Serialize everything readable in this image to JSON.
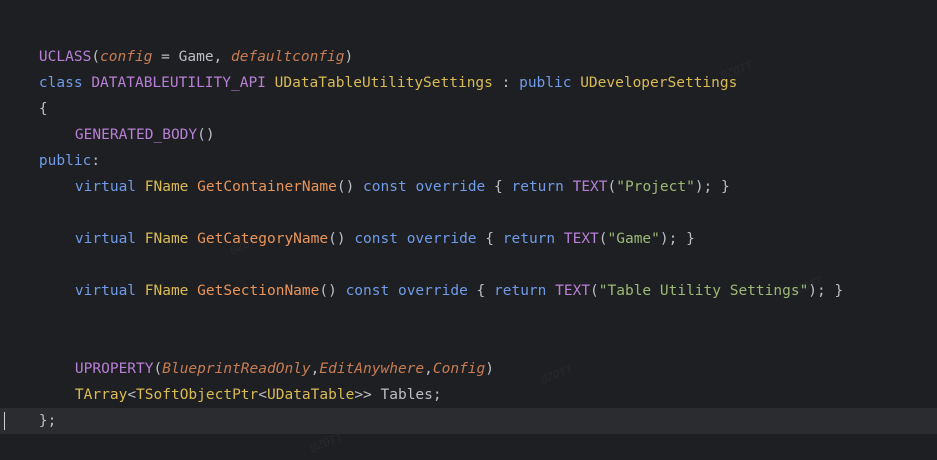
{
  "code_lines": {
    "l1": {
      "uclass": "UCLASS",
      "open": "(",
      "config": "config",
      "eq": " = Game, ",
      "defcfg": "defaultconfig",
      "close": ")"
    },
    "l2": {
      "class": "class ",
      "api": "DATATABLEUTILITY_API ",
      "name": "UDataTableUtilitySettings",
      "colon": " : ",
      "public": "public ",
      "base": "UDeveloperSettings"
    },
    "l3": {
      "brace": "{"
    },
    "l4": {
      "macro": "GENERATED_BODY",
      "parens": "()"
    },
    "l5": {
      "public": "public",
      ":": ":"
    },
    "l6": {
      "virtual": "virtual ",
      "type": "FName ",
      "func": "GetContainerName",
      "p1": "() ",
      "const": "const ",
      "override": "override ",
      "b1": "{ ",
      "ret": "return ",
      "text": "TEXT",
      "o": "(",
      "str": "\"Project\"",
      "c": "); }"
    },
    "l8": {
      "virtual": "virtual ",
      "type": "FName ",
      "func": "GetCategoryName",
      "p1": "() ",
      "const": "const ",
      "override": "override ",
      "b1": "{ ",
      "ret": "return ",
      "text": "TEXT",
      "o": "(",
      "str": "\"Game\"",
      "c": "); }"
    },
    "l10": {
      "virtual": "virtual ",
      "type": "FName ",
      "func": "GetSectionName",
      "p1": "() ",
      "const": "const ",
      "override": "override ",
      "b1": "{ ",
      "ret": "return ",
      "text": "TEXT",
      "o": "(",
      "str": "\"Table Utility Settings\"",
      "c": "); }"
    },
    "l13": {
      "macro": "UPROPERTY",
      "open": "(",
      "a1": "BlueprintReadOnly",
      "comma1": ",",
      "a2": "EditAnywhere",
      "comma2": ",",
      "a3": "Config",
      "close": ")"
    },
    "l14": {
      "tarray": "TArray",
      "lt1": "<",
      "tsoft": "TSoftObjectPtr",
      "lt2": "<",
      "udt": "UDataTable",
      "gt": ">> ",
      "var": "Tables",
      ";": ";"
    },
    "l15": {
      "close": "};"
    }
  },
  "colors": {
    "background": "#1e1f22",
    "macro": "#b87fd6",
    "keyword": "#6f9be8",
    "type": "#d9bb54",
    "function": "#e8945a",
    "string": "#9cb876",
    "plain": "#bcbec4"
  },
  "watermark": {
    "text": "@ZOTT"
  }
}
